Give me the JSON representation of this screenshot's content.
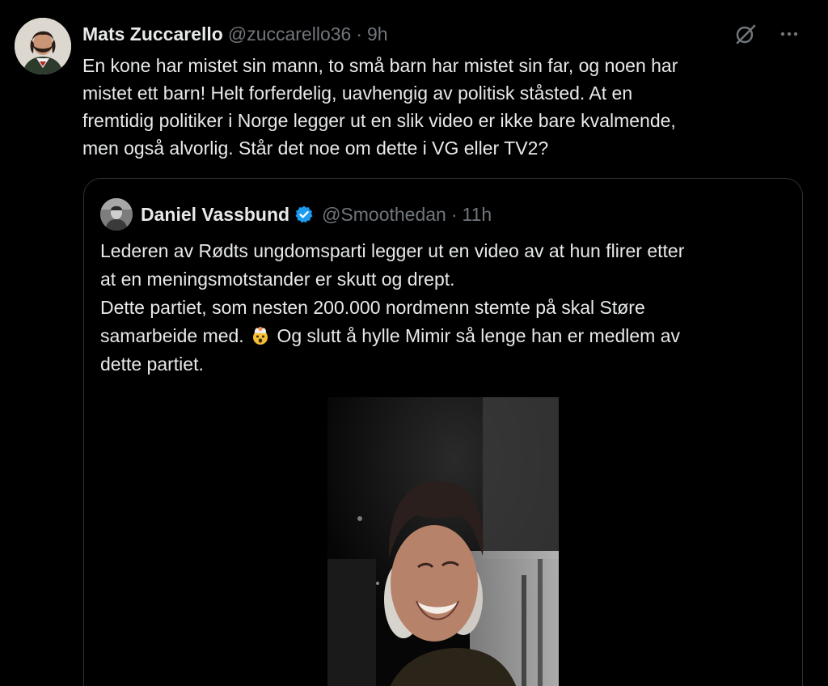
{
  "tweet": {
    "author_name": "Mats Zuccarello",
    "author_handle": "@zuccarello36",
    "separator": "·",
    "time": "9h",
    "text": "En kone har mistet sin mann, to små barn har mistet sin far, og noen har\nmistet ett barn! Helt forferdelig, uavhengig av politisk ståsted. At en\nfremtidig politiker i Norge legger ut en slik video er ikke bare kvalmende,\nmen også alvorlig. Står det noe om dette i VG eller TV2?",
    "actions": {
      "grok_icon": "grok-icon",
      "more_icon": "more-icon"
    }
  },
  "quote": {
    "author_name": "Daniel Vassbund",
    "verified": true,
    "author_handle": "@Smoothedan",
    "separator": "·",
    "time": "11h",
    "text_part1": "Lederen av Rødts ungdomsparti legger ut en video av at hun flirer etter\nat en meningsmotstander er skutt og drept.\nDette partiet, som nesten 200.000 nordmenn stemte på skal Støre\nsamarbeide med.",
    "emoji": "exploding-head",
    "text_part2": "Og slutt å hylle Mimir så lenge han er medlem av\ndette partiet."
  },
  "colors": {
    "background": "#000000",
    "text": "#e7e9ea",
    "secondary": "#71767b",
    "border": "#2f3336",
    "verified": "#1d9bf0"
  }
}
